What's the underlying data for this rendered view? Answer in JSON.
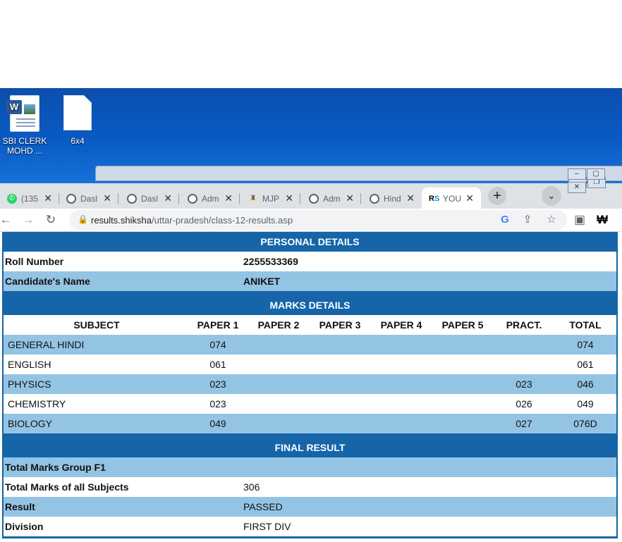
{
  "desktop": {
    "icons": [
      {
        "label_line1": "SBI CLERK",
        "label_line2": "MOHD ...",
        "icon": "word-document-icon"
      },
      {
        "label_line1": "6x4",
        "label_line2": "",
        "icon": "blank-file-icon"
      }
    ]
  },
  "browser": {
    "tabs": [
      {
        "title": "(135",
        "icon": "whatsapp-icon"
      },
      {
        "title": "Dasl",
        "icon": "globe-icon"
      },
      {
        "title": "Dasl",
        "icon": "globe-icon"
      },
      {
        "title": "Adm",
        "icon": "globe-icon"
      },
      {
        "title": "MJP",
        "icon": "university-logo-icon"
      },
      {
        "title": "Adm",
        "icon": "globe-icon"
      },
      {
        "title": "Hind",
        "icon": "globe-icon"
      },
      {
        "title": "YOU",
        "icon": "rs-logo-icon",
        "active": true
      }
    ],
    "new_tab": "+",
    "tab_search": "⌄",
    "url_host": "results.shiksha",
    "url_path": "/uttar-pradesh/class-12-results.asp"
  },
  "result": {
    "personal_header": "PERSONAL DETAILS",
    "roll_label": "Roll Number",
    "roll_value": "2255533369",
    "name_label": "Candidate's Name",
    "name_value": "ANIKET",
    "marks_header": "MARKS DETAILS",
    "columns": [
      "SUBJECT",
      "PAPER 1",
      "PAPER 2",
      "PAPER 3",
      "PAPER 4",
      "PAPER 5",
      "PRACT.",
      "TOTAL"
    ],
    "subjects": [
      {
        "name": "GENERAL HINDI",
        "p1": "074",
        "p2": "",
        "p3": "",
        "p4": "",
        "p5": "",
        "pract": "",
        "total": "074"
      },
      {
        "name": "ENGLISH",
        "p1": "061",
        "p2": "",
        "p3": "",
        "p4": "",
        "p5": "",
        "pract": "",
        "total": "061"
      },
      {
        "name": "PHYSICS",
        "p1": "023",
        "p2": "",
        "p3": "",
        "p4": "",
        "p5": "",
        "pract": "023",
        "total": "046"
      },
      {
        "name": "CHEMISTRY",
        "p1": "023",
        "p2": "",
        "p3": "",
        "p4": "",
        "p5": "",
        "pract": "026",
        "total": "049"
      },
      {
        "name": "BIOLOGY",
        "p1": "049",
        "p2": "",
        "p3": "",
        "p4": "",
        "p5": "",
        "pract": "027",
        "total": "076D"
      }
    ],
    "final_header": "FINAL RESULT",
    "group_label": "Total Marks Group F1",
    "group_value": "",
    "all_label": "Total Marks of all Subjects",
    "all_value": "306",
    "result_label": "Result",
    "result_value": "PASSED",
    "division_label": "Division",
    "division_value": "FIRST DIV"
  },
  "colors": {
    "header_blue": "#1565a8",
    "row_light_blue": "#94c4e4",
    "desktop_blue": "#0a5ac4"
  }
}
